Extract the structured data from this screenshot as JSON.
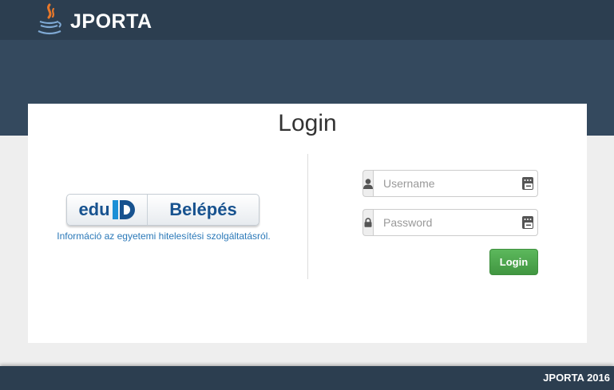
{
  "header": {
    "brand": "JPORTA",
    "logo_icon": "java-cup-icon"
  },
  "login": {
    "title": "Login"
  },
  "eduid": {
    "logo_text": "edu",
    "logo_mark": "ID",
    "button_label": "Belépés",
    "info_link": "Információ az egyetemi hitelesítési szolgáltatásról."
  },
  "form": {
    "username_placeholder": "Username",
    "password_placeholder": "Password",
    "username_icon": "user-icon",
    "password_icon": "lock-icon",
    "login_label": "Login"
  },
  "footer": {
    "text": "JPORTA 2016"
  },
  "colors": {
    "header": "#2c3e50",
    "hero": "#34495e",
    "accent": "#5cb85c",
    "link": "#2a78b8"
  }
}
